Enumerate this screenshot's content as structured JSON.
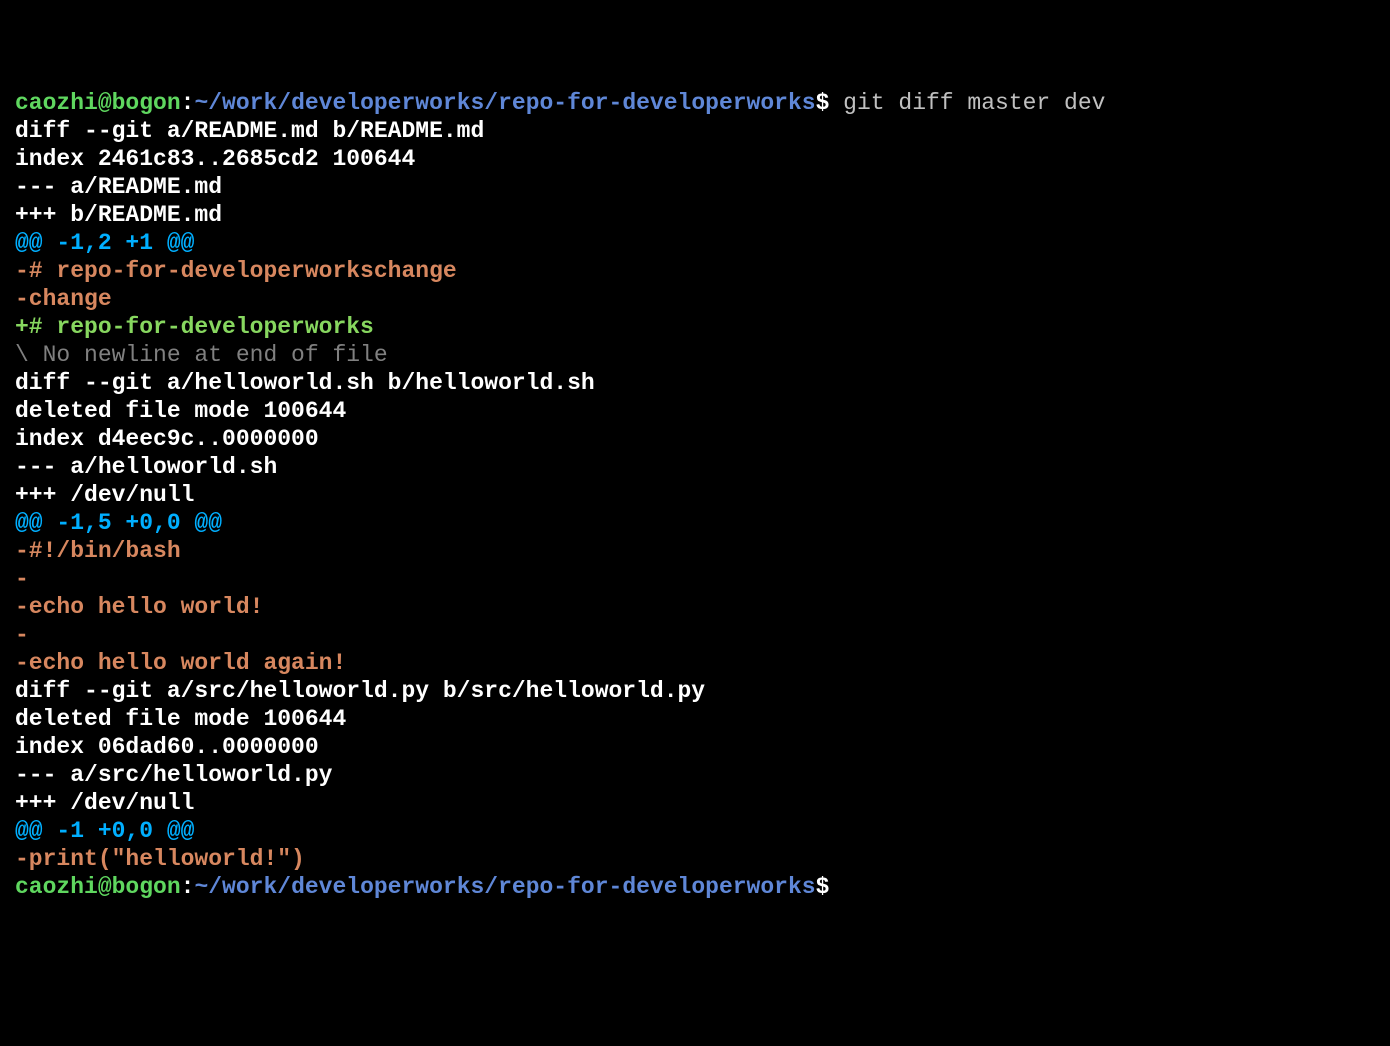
{
  "prompt1": {
    "user_host": "caozhi@bogon",
    "colon": ":",
    "path": "~/work/developerworks/repo-for-developerworks",
    "dollar": "$",
    "command": " git diff master dev"
  },
  "diff": [
    {
      "cls": "c-white-bold",
      "text": "diff --git a/README.md b/README.md"
    },
    {
      "cls": "c-white-bold",
      "text": "index 2461c83..2685cd2 100644"
    },
    {
      "cls": "c-white-bold",
      "text": "--- a/README.md"
    },
    {
      "cls": "c-white-bold",
      "text": "+++ b/README.md"
    },
    {
      "cls": "c-hunk",
      "text": "@@ -1,2 +1 @@"
    },
    {
      "cls": "c-minus",
      "text": "-# repo-for-developerworkschange"
    },
    {
      "cls": "c-minus",
      "text": "-change"
    },
    {
      "cls": "c-plus",
      "text": "+# repo-for-developerworks"
    },
    {
      "cls": "c-comment",
      "text": "\\ No newline at end of file"
    },
    {
      "cls": "c-white-bold",
      "text": "diff --git a/helloworld.sh b/helloworld.sh"
    },
    {
      "cls": "c-white-bold",
      "text": "deleted file mode 100644"
    },
    {
      "cls": "c-white-bold",
      "text": "index d4eec9c..0000000"
    },
    {
      "cls": "c-white-bold",
      "text": "--- a/helloworld.sh"
    },
    {
      "cls": "c-white-bold",
      "text": "+++ /dev/null"
    },
    {
      "cls": "c-hunk",
      "text": "@@ -1,5 +0,0 @@"
    },
    {
      "cls": "c-minus",
      "text": "-#!/bin/bash"
    },
    {
      "cls": "c-minus",
      "text": "-"
    },
    {
      "cls": "c-minus",
      "text": "-echo hello world!"
    },
    {
      "cls": "c-minus",
      "text": "-"
    },
    {
      "cls": "c-minus",
      "text": "-echo hello world again!"
    },
    {
      "cls": "c-white-bold",
      "text": "diff --git a/src/helloworld.py b/src/helloworld.py"
    },
    {
      "cls": "c-white-bold",
      "text": "deleted file mode 100644"
    },
    {
      "cls": "c-white-bold",
      "text": "index 06dad60..0000000"
    },
    {
      "cls": "c-white-bold",
      "text": "--- a/src/helloworld.py"
    },
    {
      "cls": "c-white-bold",
      "text": "+++ /dev/null"
    },
    {
      "cls": "c-hunk",
      "text": "@@ -1 +0,0 @@"
    },
    {
      "cls": "c-minus",
      "text": "-print(\"helloworld!\")"
    }
  ],
  "prompt2": {
    "user_host": "caozhi@bogon",
    "colon": ":",
    "path": "~/work/developerworks/repo-for-developerworks",
    "dollar": "$"
  }
}
